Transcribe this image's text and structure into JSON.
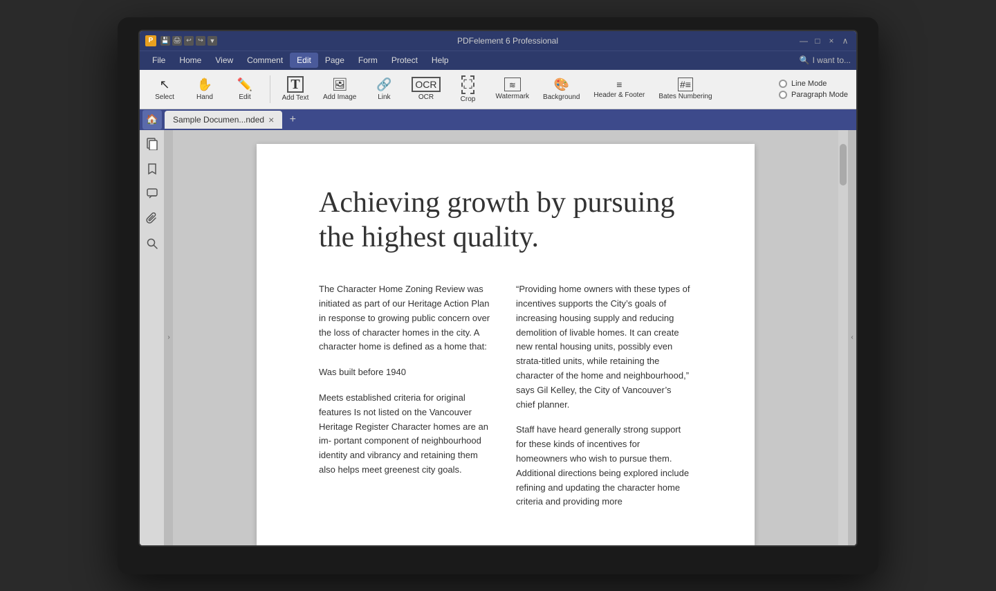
{
  "titleBar": {
    "title": "PDFelement 6 Professional",
    "iconLabel": "P",
    "minimizeLabel": "—",
    "maximizeLabel": "□",
    "closeLabel": "×",
    "collapseLabel": "∧"
  },
  "menuBar": {
    "items": [
      "File",
      "Home",
      "View",
      "Comment",
      "Edit",
      "Page",
      "Form",
      "Protect",
      "Help"
    ],
    "activeItem": "Edit",
    "searchPlaceholder": "I want to...",
    "searchIcon": "search-icon"
  },
  "toolbar": {
    "tools": [
      {
        "id": "select",
        "label": "Select",
        "icon": "cursor"
      },
      {
        "id": "hand",
        "label": "Hand",
        "icon": "hand"
      },
      {
        "id": "edit",
        "label": "Edit",
        "icon": "edit"
      },
      {
        "id": "add-text",
        "label": "Add Text",
        "icon": "text"
      },
      {
        "id": "add-image",
        "label": "Add Image",
        "icon": "image"
      },
      {
        "id": "link",
        "label": "Link",
        "icon": "link"
      },
      {
        "id": "ocr",
        "label": "OCR",
        "icon": "ocr"
      },
      {
        "id": "crop",
        "label": "Crop",
        "icon": "crop"
      },
      {
        "id": "watermark",
        "label": "Watermark",
        "icon": "watermark"
      },
      {
        "id": "background",
        "label": "Background",
        "icon": "background"
      },
      {
        "id": "header-footer",
        "label": "Header & Footer",
        "icon": "header"
      },
      {
        "id": "bates",
        "label": "Bates Numbering",
        "icon": "bates"
      }
    ],
    "modes": {
      "lineMode": "Line Mode",
      "paragraphMode": "Paragraph Mode"
    }
  },
  "tabs": {
    "homeIcon": "🏠",
    "items": [
      {
        "label": "Sample Documen...nded",
        "closable": true
      }
    ],
    "addLabel": "+"
  },
  "sidebar": {
    "icons": [
      {
        "id": "pages",
        "icon": "pages",
        "active": false
      },
      {
        "id": "bookmarks",
        "icon": "bookmark",
        "active": false
      },
      {
        "id": "comments",
        "icon": "comment",
        "active": false
      },
      {
        "id": "attachments",
        "icon": "attachment",
        "active": false
      },
      {
        "id": "search",
        "icon": "search",
        "active": false
      }
    ]
  },
  "document": {
    "title": "Achieving growth by pursuing the highest quality.",
    "col1": {
      "p1": " The Character Home Zoning Review was initiated as part of our Heritage Action Plan in response to growing public concern over the loss of character homes in the city.  A character home is defined as a home that:",
      "p2": "Was built before 1940",
      "p3": "Meets established criteria for original features Is not listed on the Vancouver Heritage Register Character homes are an im- portant component of neighbourhood identity and vibrancy and retaining them also helps meet greenest city goals."
    },
    "col2": {
      "p1": "“Providing home owners with these types of incentives supports the City’s goals of increasing housing supply and reducing demolition of livable homes.  It can create new rental housing units, possibly even strata-titled units, while retaining the character of the home and neighbourhood,” says Gil Kelley, the City of Vancouver’s chief planner.",
      "p2": "Staff have heard generally strong support for these kinds of incentives for homeowners who wish to pursue them. Additional directions being explored include refining and updating the character home criteria and providing more"
    }
  }
}
